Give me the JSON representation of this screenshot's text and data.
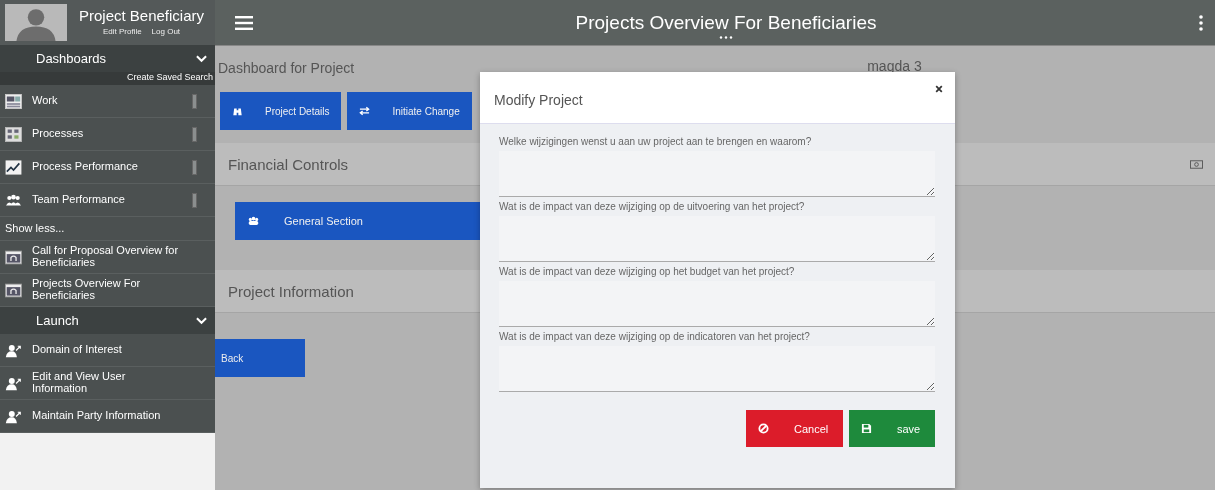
{
  "sidebar": {
    "user": {
      "name": "Project Beneficiary",
      "links": [
        "Edit Profile",
        "Log Out"
      ]
    },
    "sections": [
      {
        "title": "Dashboards",
        "expanded": true,
        "action": "Create Saved Search",
        "items": [
          {
            "label": "Work",
            "kind": "board"
          },
          {
            "label": "Processes",
            "kind": "processes"
          },
          {
            "label": "Process Performance",
            "kind": "chart"
          },
          {
            "label": "Team Performance",
            "kind": "team"
          },
          {
            "label": "Show less...",
            "kind": "toggle"
          },
          {
            "label": "Call for Proposal Overview for Beneficiaries",
            "kind": "page"
          },
          {
            "label": "Projects Overview For Beneficiaries",
            "kind": "page"
          }
        ]
      },
      {
        "title": "Launch",
        "expanded": true,
        "items": [
          {
            "label": "Domain of Interest",
            "kind": "user"
          },
          {
            "label": "Edit and View User Information",
            "kind": "user"
          },
          {
            "label": "Maintain Party Information",
            "kind": "user"
          }
        ]
      }
    ]
  },
  "header": {
    "title": "Projects Overview For Beneficiaries"
  },
  "dashboard": {
    "title": "Dashboard for Project",
    "owner": "magda 3",
    "actions": [
      {
        "label": "Project Details",
        "kind": "details"
      },
      {
        "label": "Initiate Change",
        "kind": "change"
      }
    ],
    "sections": [
      {
        "title": "Financial Controls",
        "buttons": [
          {
            "label": "General Section",
            "kind": "group"
          }
        ]
      },
      {
        "title": "Project Information"
      }
    ],
    "back": "Back"
  },
  "modal": {
    "title": "Modify Project",
    "fields": [
      {
        "label": "Welke wijzigingen wenst u aan uw project aan te brengen en waarom?"
      },
      {
        "label": "Wat is de impact van deze wijziging op de uitvoering van het project?"
      },
      {
        "label": "Wat is de impact van deze wijziging op het budget van het project?"
      },
      {
        "label": "Wat is de impact van deze wijziging op de indicatoren van het project?"
      }
    ],
    "buttons": [
      {
        "label": "Cancel",
        "kind": "cancel"
      },
      {
        "label": "save",
        "kind": "save"
      }
    ]
  }
}
